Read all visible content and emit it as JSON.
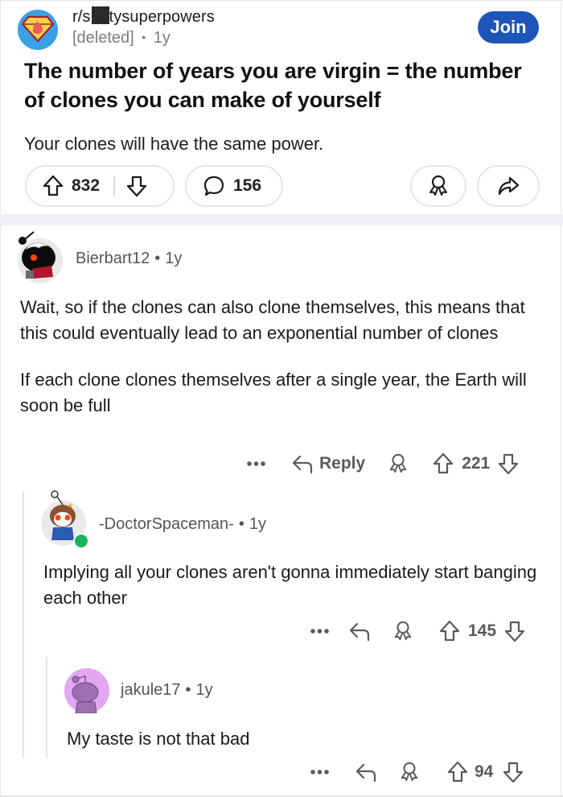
{
  "post": {
    "subreddit_prefix": "r/s",
    "subreddit_suffix": "tysuperpowers",
    "author": "[deleted]",
    "age": "1y",
    "meta_separator": "•",
    "join_label": "Join",
    "title": "The number of years you are virgin = the number of clones you can make of yourself",
    "body": "Your clones will have the same power.",
    "upvotes": "832",
    "comments": "156",
    "colors": {
      "join_bg": "#1e55b8",
      "divider": "#eef0f3"
    }
  },
  "comments": [
    {
      "username": "Bierbart12",
      "age": "1y",
      "paragraphs": [
        "Wait, so if the clones can also clone themselves, this means that this could eventually lead to an exponential number of clones",
        "If each clone clones themselves after a single year, the Earth will soon be full"
      ],
      "more_label": "•••",
      "reply_label": "Reply",
      "votes": "221"
    },
    {
      "username": "-DoctorSpaceman-",
      "age": "1y",
      "online": true,
      "paragraphs": [
        "Implying all your clones aren't gonna immediately start banging each other"
      ],
      "more_label": "•••",
      "votes": "145"
    },
    {
      "username": "jakule17",
      "age": "1y",
      "paragraphs": [
        "My taste is not that bad"
      ],
      "more_label": "•••",
      "votes": "94"
    }
  ],
  "icons": {
    "subreddit": "superhero-shield-icon",
    "upvote": "arrow-up-icon",
    "downvote": "arrow-down-icon",
    "comment": "speech-bubble-icon",
    "award": "award-ribbon-icon",
    "share": "share-arrow-icon",
    "reply": "reply-arrow-icon",
    "more": "ellipsis-icon"
  }
}
